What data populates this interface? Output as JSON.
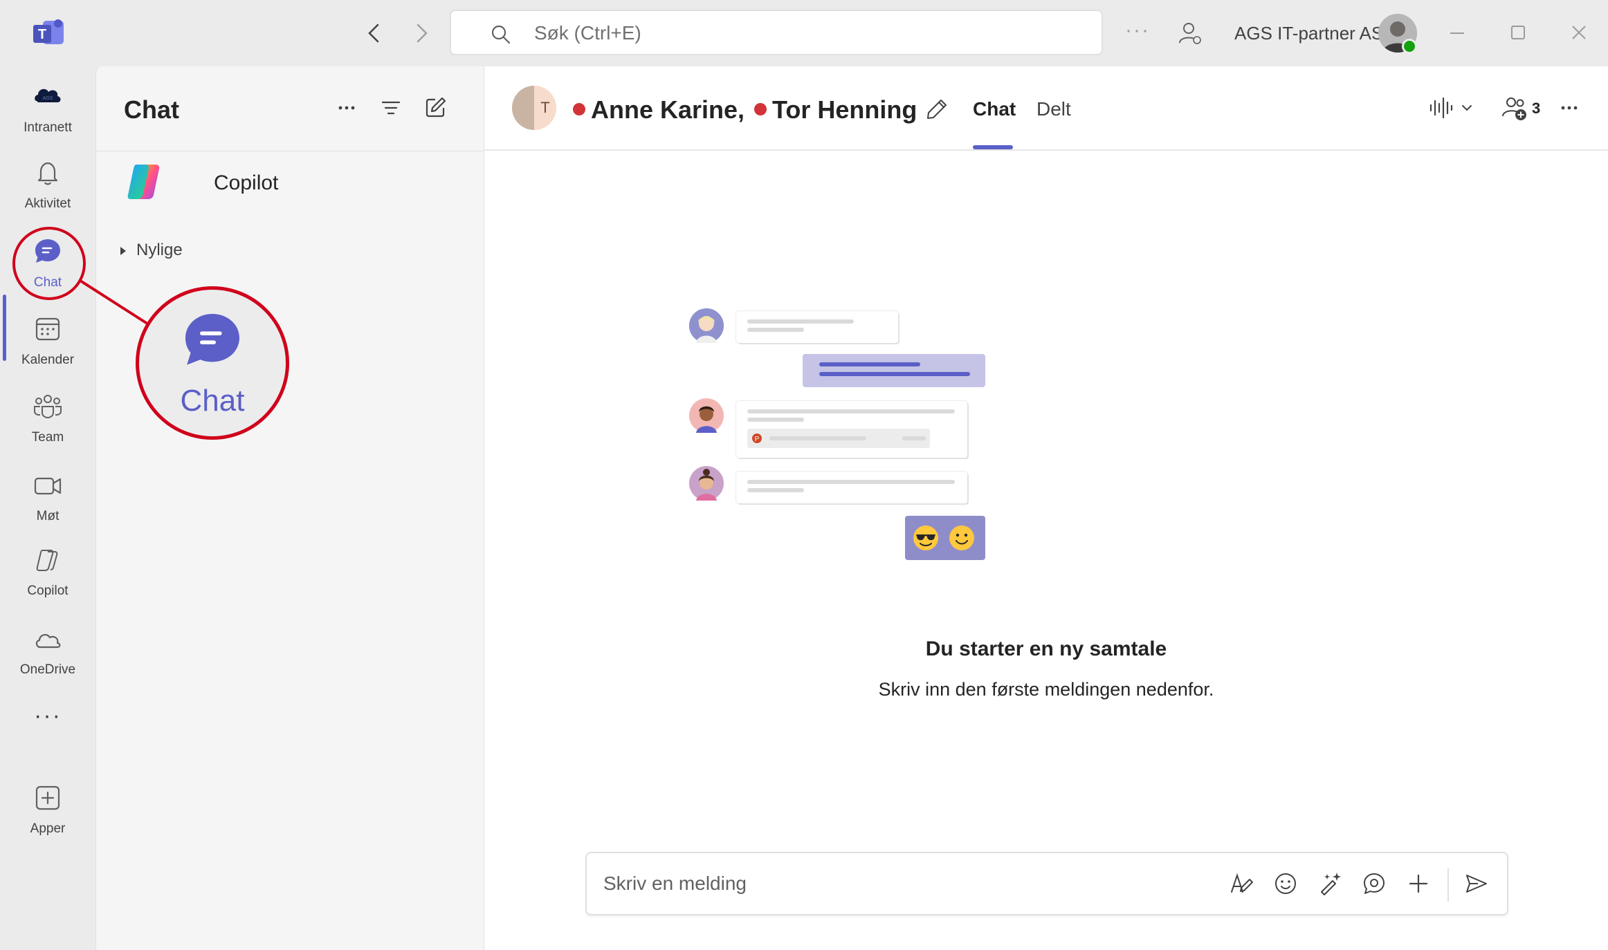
{
  "titlebar": {
    "search_placeholder": "Søk (Ctrl+E)",
    "more": "···",
    "org_name": "AGS IT-partner AS"
  },
  "rail": {
    "items": [
      {
        "label": "Intranett",
        "icon": "ags-logo-icon"
      },
      {
        "label": "Aktivitet",
        "icon": "bell-icon"
      },
      {
        "label": "Chat",
        "icon": "chat-icon",
        "active": true
      },
      {
        "label": "Kalender",
        "icon": "calendar-icon"
      },
      {
        "label": "Team",
        "icon": "team-icon"
      },
      {
        "label": "Møt",
        "icon": "video-icon"
      },
      {
        "label": "Copilot",
        "icon": "copilot-icon"
      },
      {
        "label": "OneDrive",
        "icon": "cloud-icon"
      },
      {
        "label": "···",
        "icon": "more-icon"
      },
      {
        "label": "Apper",
        "icon": "add-app-icon"
      }
    ],
    "accent": "#5b5fc7"
  },
  "listpane": {
    "title": "Chat",
    "copilot_label": "Copilot",
    "recent_label": "Nylige"
  },
  "chat": {
    "avatar_initial": "T",
    "participants": [
      "Anne Karine,",
      "Tor Henning"
    ],
    "presence_color": "#d13438",
    "tabs": [
      "Chat",
      "Delt"
    ],
    "active_tab": "Chat",
    "participant_count": "3",
    "empty_title": "Du starter en ny samtale",
    "empty_subtitle": "Skriv inn den første meldingen nedenfor.",
    "compose_placeholder": "Skriv en melding"
  },
  "callout": {
    "label": "Chat",
    "color": "#d0021b"
  }
}
